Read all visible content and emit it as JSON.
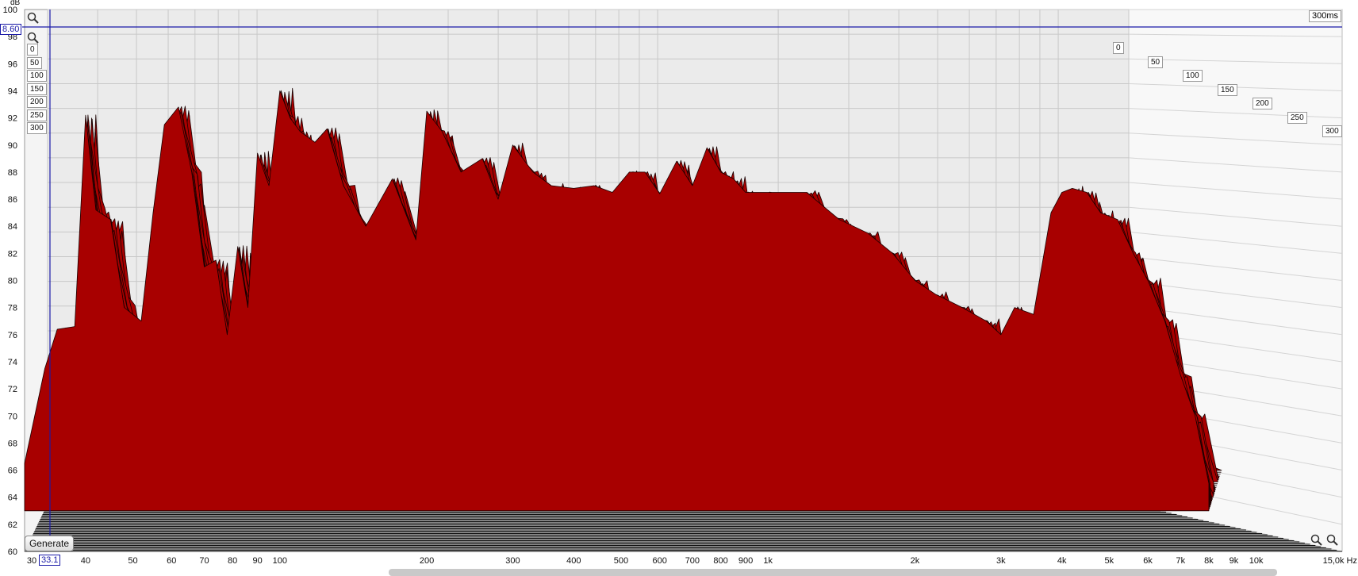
{
  "chart_data": {
    "type": "area",
    "title": "",
    "ylabel": "dB",
    "xlabel": "Hz",
    "y_ticks": [
      100,
      98,
      96,
      94,
      92,
      90,
      88,
      86,
      84,
      82,
      80,
      78,
      76,
      74,
      72,
      70,
      68,
      66,
      64,
      62,
      60
    ],
    "x_tick_labels": [
      "30",
      "40",
      "50",
      "60",
      "70",
      "80",
      "90",
      "100",
      "200",
      "300",
      "400",
      "500",
      "600",
      "700",
      "800",
      "900",
      "1k",
      "2k",
      "3k",
      "4k",
      "5k",
      "6k",
      "7k",
      "8k",
      "9k",
      "10k",
      "15,0k Hz"
    ],
    "x_tick_values": [
      30,
      40,
      50,
      60,
      70,
      80,
      90,
      100,
      200,
      300,
      400,
      500,
      600,
      700,
      800,
      900,
      1000,
      2000,
      3000,
      4000,
      5000,
      6000,
      7000,
      8000,
      9000,
      10000,
      15000
    ],
    "xlim": [
      30,
      15000
    ],
    "ylim": [
      60,
      100
    ],
    "x_scale": "log",
    "depth_axis_labels": [
      "0",
      "50",
      "100",
      "150",
      "200",
      "250",
      "300"
    ],
    "depth_max_label": "300ms",
    "front_slice_peaks": {
      "freq": [
        30,
        33,
        35,
        38,
        40,
        42,
        45,
        48,
        52,
        55,
        58,
        62,
        66,
        70,
        74,
        78,
        82,
        86,
        90,
        95,
        100,
        105,
        110,
        118,
        125,
        135,
        150,
        170,
        190,
        200,
        215,
        235,
        260,
        280,
        300,
        330,
        360,
        400,
        440,
        480,
        520,
        560,
        600,
        650,
        700,
        750,
        800,
        850,
        900,
        1000,
        1200,
        1400,
        1600,
        1800,
        2000,
        2200,
        2500,
        2800,
        3000,
        3200,
        3500,
        3800,
        4000,
        4200,
        4500,
        4800,
        5200,
        5600,
        6000,
        6500,
        7000,
        7500,
        8000
      ],
      "db": [
        66.5,
        73.5,
        76.4,
        76.6,
        92.2,
        85.2,
        84.5,
        78,
        77,
        85,
        91.5,
        92.8,
        88,
        81,
        81.5,
        76,
        82.5,
        78,
        89.4,
        87,
        94,
        92,
        91,
        90.2,
        91.2,
        87,
        84,
        87.5,
        83,
        92.5,
        91,
        88,
        89,
        86,
        90,
        88,
        87,
        86.8,
        87,
        86.5,
        88,
        88,
        86.4,
        88.8,
        87,
        89.8,
        88,
        87.5,
        86.5,
        86.5,
        86.5,
        84.5,
        83.5,
        82,
        80,
        79,
        78,
        77,
        76,
        78,
        77.5,
        85,
        86.5,
        86.8,
        86.5,
        85,
        84.5,
        82,
        80,
        77,
        73,
        70,
        65
      ]
    }
  },
  "readouts": {
    "cursor_x": "33.1",
    "cursor_y": "8.60"
  },
  "buttons": {
    "generate": "Generate"
  },
  "colors": {
    "surface": "#a80000",
    "surface_dark": "#5a0000",
    "back_wall": "#ebebeb",
    "cursor": "#1a1aa8"
  },
  "icons": [
    "zoom-in-icon",
    "zoom-out-icon"
  ]
}
